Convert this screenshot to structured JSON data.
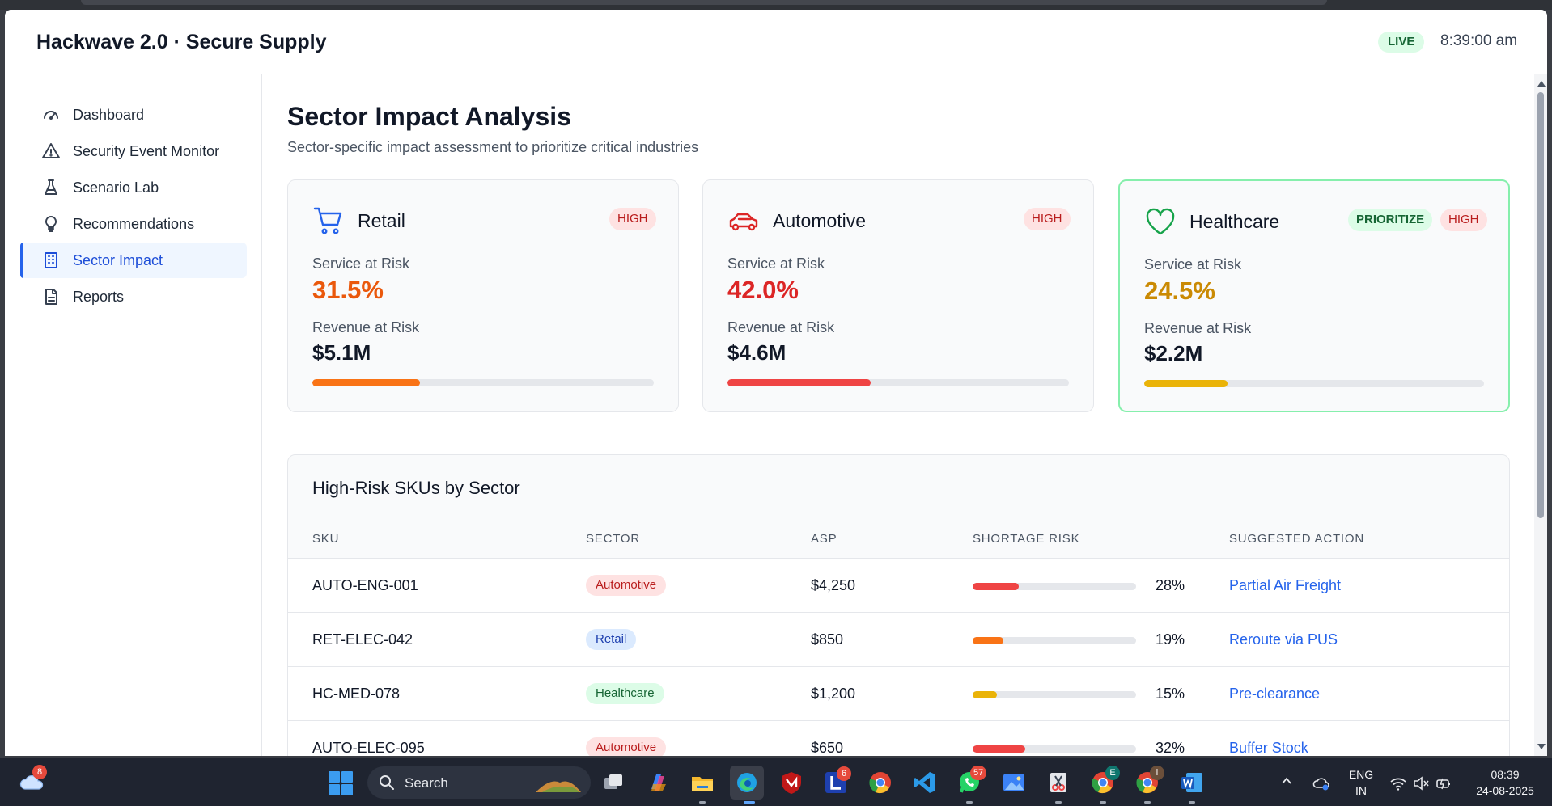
{
  "app": {
    "title": "Hackwave 2.0 · Secure Supply",
    "live_label": "LIVE",
    "clock": "8:39:00 am"
  },
  "sidebar": {
    "items": [
      {
        "label": "Dashboard",
        "icon": "gauge-icon",
        "active": false
      },
      {
        "label": "Security Event Monitor",
        "icon": "alert-triangle-icon",
        "active": false
      },
      {
        "label": "Scenario Lab",
        "icon": "flask-icon",
        "active": false
      },
      {
        "label": "Recommendations",
        "icon": "lightbulb-icon",
        "active": false
      },
      {
        "label": "Sector Impact",
        "icon": "building-icon",
        "active": true
      },
      {
        "label": "Reports",
        "icon": "document-icon",
        "active": false
      }
    ]
  },
  "page": {
    "title": "Sector Impact Analysis",
    "subtitle": "Sector-specific impact assessment to prioritize critical industries"
  },
  "cards": [
    {
      "name": "Retail",
      "icon": "shopping-cart-icon",
      "icon_color": "#2563eb",
      "badge": "HIGH",
      "prioritize": "",
      "service_label": "Service at Risk",
      "service_value": "31.5%",
      "service_color": "#ea580c",
      "revenue_label": "Revenue at Risk",
      "revenue_value": "$5.1M",
      "bar_fraction": 0.315,
      "bar_color": "#f97316"
    },
    {
      "name": "Automotive",
      "icon": "car-icon",
      "icon_color": "#dc2626",
      "badge": "HIGH",
      "prioritize": "",
      "service_label": "Service at Risk",
      "service_value": "42.0%",
      "service_color": "#dc2626",
      "revenue_label": "Revenue at Risk",
      "revenue_value": "$4.6M",
      "bar_fraction": 0.42,
      "bar_color": "#ef4444"
    },
    {
      "name": "Healthcare",
      "icon": "heart-icon",
      "icon_color": "#16a34a",
      "badge": "HIGH",
      "prioritize": "PRIORITIZE",
      "service_label": "Service at Risk",
      "service_value": "24.5%",
      "service_color": "#ca8a04",
      "revenue_label": "Revenue at Risk",
      "revenue_value": "$2.2M",
      "bar_fraction": 0.245,
      "bar_color": "#eab308"
    }
  ],
  "table": {
    "title": "High-Risk SKUs by Sector",
    "columns": [
      "SKU",
      "SECTOR",
      "ASP",
      "SHORTAGE RISK",
      "SUGGESTED ACTION"
    ],
    "rows": [
      {
        "sku": "AUTO-ENG-001",
        "sector": "Automotive",
        "asp": "$4,250",
        "risk": 0.28,
        "risk_label": "28%",
        "action": "Partial Air Freight"
      },
      {
        "sku": "RET-ELEC-042",
        "sector": "Retail",
        "asp": "$850",
        "risk": 0.19,
        "risk_label": "19%",
        "action": "Reroute via PUS"
      },
      {
        "sku": "HC-MED-078",
        "sector": "Healthcare",
        "asp": "$1,200",
        "risk": 0.15,
        "risk_label": "15%",
        "action": "Pre-clearance"
      },
      {
        "sku": "AUTO-ELEC-095",
        "sector": "Automotive",
        "asp": "$650",
        "risk": 0.32,
        "risk_label": "32%",
        "action": "Buffer Stock"
      }
    ],
    "sector_colors": {
      "Automotive": {
        "bg": "#fee2e2",
        "fg": "#b91c1c"
      },
      "Retail": {
        "bg": "#dbeafe",
        "fg": "#1e40af"
      },
      "Healthcare": {
        "bg": "#dcfce7",
        "fg": "#166534"
      }
    },
    "risk_colors": {
      "high": "#ef4444",
      "medium": "#f97316",
      "low": "#eab308"
    }
  },
  "taskbar": {
    "weather_badge": "8",
    "search_label": "Search",
    "apps": [
      {
        "name": "task-view-icon"
      },
      {
        "name": "copilot-icon"
      },
      {
        "name": "file-explorer-icon"
      },
      {
        "name": "edge-browser-icon"
      },
      {
        "name": "mcafee-icon"
      },
      {
        "name": "l-app-icon",
        "badge": "6"
      },
      {
        "name": "chrome-icon"
      },
      {
        "name": "vscode-icon"
      },
      {
        "name": "whatsapp-icon",
        "badge": "57"
      },
      {
        "name": "photos-icon"
      },
      {
        "name": "snipping-tool-icon"
      },
      {
        "name": "chrome-profile-e-icon",
        "badge": "E"
      },
      {
        "name": "chrome-profile-i-icon",
        "badge": "i"
      },
      {
        "name": "word-icon"
      }
    ],
    "lang_top": "ENG",
    "lang_bottom": "IN",
    "time": "08:39",
    "date": "24-08-2025"
  }
}
